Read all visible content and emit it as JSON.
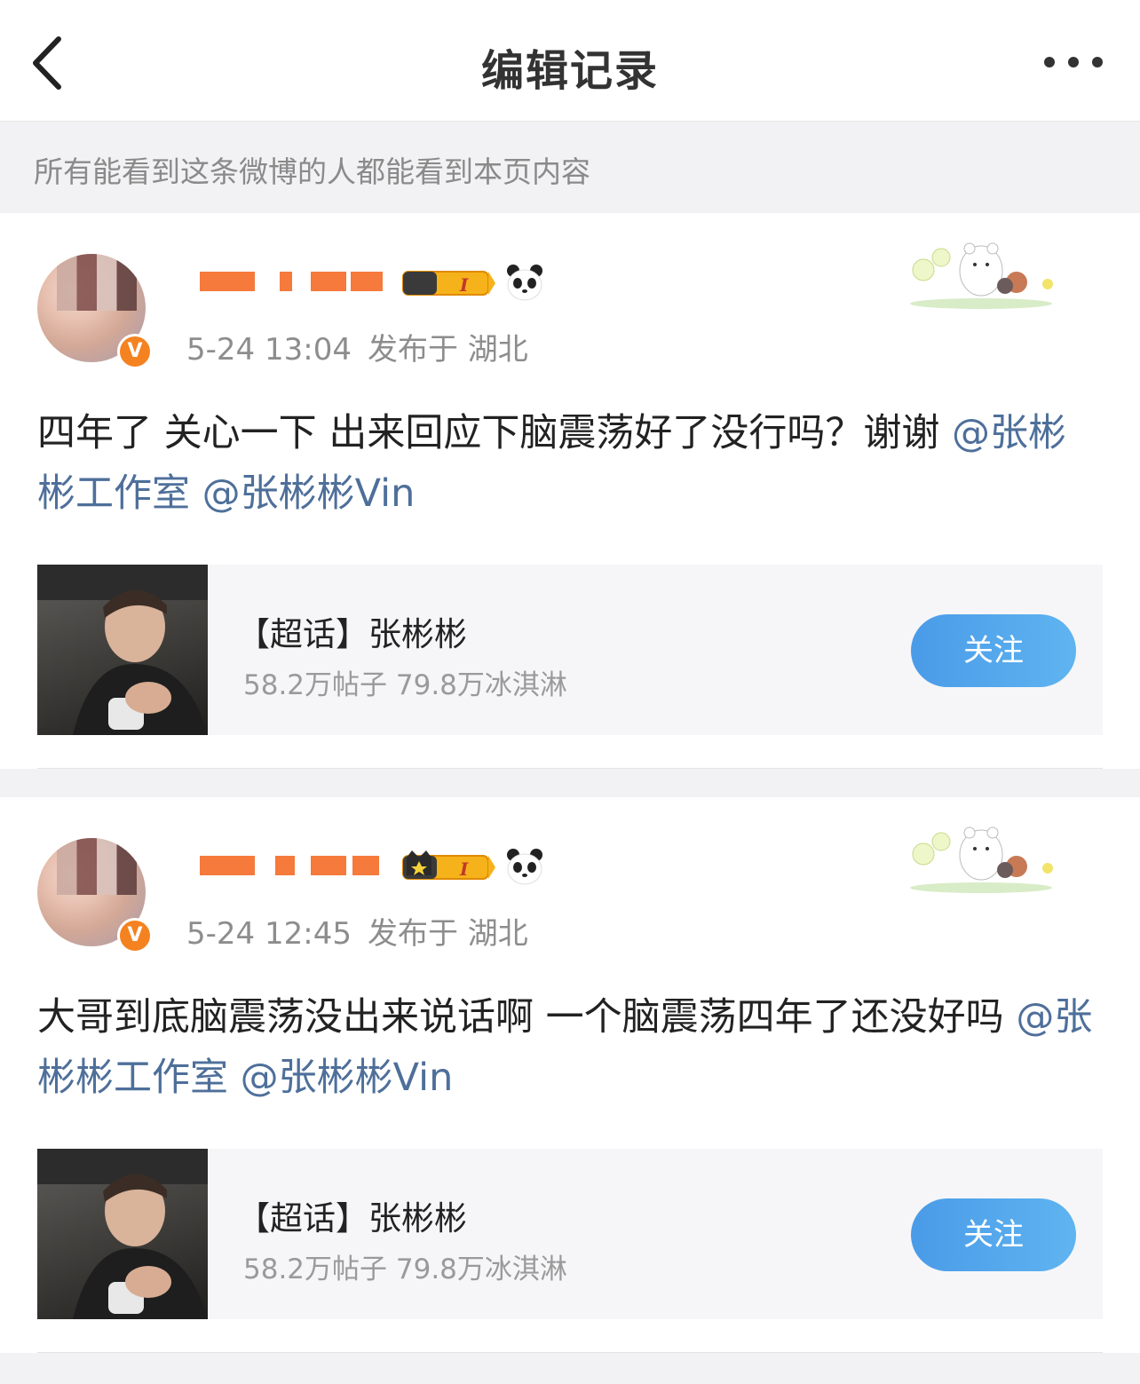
{
  "header": {
    "title": "编辑记录",
    "back_icon": "chevron-left-icon",
    "more_icon": "more-horizontal-icon"
  },
  "notice": "所有能看到这条微博的人都能看到本页内容",
  "posts": [
    {
      "timestamp": "5-24 13:04",
      "location": "发布于 湖北",
      "text_main": "四年了 关心一下 出来回应下脑震荡好了没行吗？谢谢 ",
      "mention_1": "@张彬彬工作室",
      "mention_2": "@张彬彬Vin",
      "level_badge": "I",
      "supertopic": {
        "title": "【超话】张彬彬",
        "stats": "58.2万帖子 79.8万冰淇淋",
        "follow_label": "关注"
      }
    },
    {
      "timestamp": "5-24 12:45",
      "location": "发布于 湖北",
      "text_main": "大哥到底脑震荡没出来说话啊 一个脑震荡四年了还没好吗 ",
      "mention_1": "@张彬彬工作室",
      "mention_2": "@张彬彬Vin",
      "level_badge": "I",
      "supertopic": {
        "title": "【超话】张彬彬",
        "stats": "58.2万帖子 79.8万冰淇淋",
        "follow_label": "关注"
      }
    }
  ],
  "verified_badge": "V",
  "colors": {
    "accent_blue": "#4a9be8",
    "mention": "#4e6f9a",
    "verified_orange": "#f58220"
  }
}
